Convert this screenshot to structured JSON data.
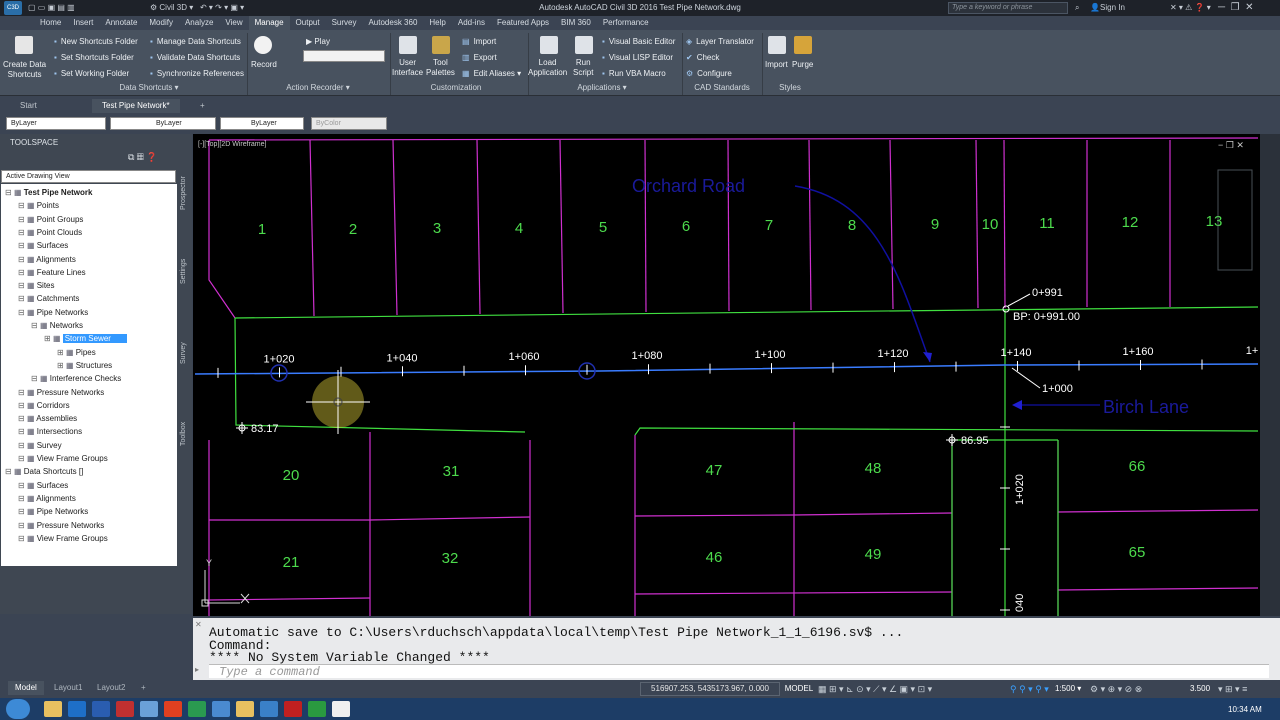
{
  "titlebar": {
    "app_label": "C3D",
    "workspace": "Civil 3D",
    "title": "Autodesk AutoCAD Civil 3D 2016    Test Pipe Network.dwg",
    "search_placeholder": "Type a keyword or phrase",
    "sign_in": "Sign In"
  },
  "ribbon_tabs": [
    "Home",
    "Insert",
    "Annotate",
    "Modify",
    "Analyze",
    "View",
    "Manage",
    "Output",
    "Survey",
    "Autodesk 360",
    "Help",
    "Add-ins",
    "Featured Apps",
    "BIM 360",
    "Performance"
  ],
  "active_tab": "Manage",
  "ribbon": {
    "create_ds": "Create Data\nShortcuts",
    "ds_items": [
      "New Shortcuts Folder",
      "Set Shortcuts Folder",
      "Set Working Folder"
    ],
    "ds_items2": [
      "Manage Data Shortcuts",
      "Validate Data Shortcuts",
      "Synchronize References"
    ],
    "ds_panel": "Data Shortcuts ▾",
    "record": "Record",
    "play": "Play",
    "action_panel": "Action Recorder ▾",
    "cui": "User\nInterface",
    "tool_palettes": "Tool\nPalettes",
    "cust_items": [
      "Import",
      "Export",
      "Edit Aliases ▾"
    ],
    "cust_panel": "Customization",
    "load_app": "Load\nApplication",
    "run_script": "Run\nScript",
    "app_items": [
      "Visual Basic Editor",
      "Visual LISP Editor",
      "Run VBA Macro"
    ],
    "app_panel": "Applications ▾",
    "cad_items": [
      "Layer Translator",
      "Check",
      "Configure"
    ],
    "cad_panel": "CAD Standards",
    "import": "Import",
    "purge": "Purge",
    "styles_panel": "Styles"
  },
  "doc_tabs": [
    "Start",
    "Test Pipe Network*"
  ],
  "properties": {
    "layer": "ByLayer",
    "linetype": "ByLayer",
    "lineweight": "ByLayer",
    "color": "ByColor"
  },
  "toolspace": {
    "title": "TOOLSPACE",
    "view": "Active Drawing View",
    "side_tabs": [
      "Prospector",
      "Settings",
      "Survey",
      "Toolbox"
    ],
    "tree": [
      {
        "t": "Test Pipe Network",
        "l": 0,
        "b": true
      },
      {
        "t": "Points",
        "l": 1
      },
      {
        "t": "Point Groups",
        "l": 1
      },
      {
        "t": "Point Clouds",
        "l": 1
      },
      {
        "t": "Surfaces",
        "l": 1
      },
      {
        "t": "Alignments",
        "l": 1
      },
      {
        "t": "Feature Lines",
        "l": 1
      },
      {
        "t": "Sites",
        "l": 1
      },
      {
        "t": "Catchments",
        "l": 1
      },
      {
        "t": "Pipe Networks",
        "l": 1
      },
      {
        "t": "Networks",
        "l": 2
      },
      {
        "t": "Storm Sewer",
        "l": 3,
        "sel": true
      },
      {
        "t": "Pipes",
        "l": 4
      },
      {
        "t": "Structures",
        "l": 4
      },
      {
        "t": "Interference Checks",
        "l": 2
      },
      {
        "t": "Pressure Networks",
        "l": 1
      },
      {
        "t": "Corridors",
        "l": 1
      },
      {
        "t": "Assemblies",
        "l": 1
      },
      {
        "t": "Intersections",
        "l": 1
      },
      {
        "t": "Survey",
        "l": 1
      },
      {
        "t": "View Frame Groups",
        "l": 1
      },
      {
        "t": "Data Shortcuts []",
        "l": 0
      },
      {
        "t": "Surfaces",
        "l": 1
      },
      {
        "t": "Alignments",
        "l": 1
      },
      {
        "t": "Pipe Networks",
        "l": 1
      },
      {
        "t": "Pressure Networks",
        "l": 1
      },
      {
        "t": "View Frame Groups",
        "l": 1
      }
    ]
  },
  "viewport": {
    "label": "[-][Top][2D Wireframe]",
    "road1": "Orchard Road",
    "road2": "Birch Lane",
    "lots_top": [
      "1",
      "2",
      "3",
      "4",
      "5",
      "6",
      "7",
      "8",
      "9",
      "10",
      "11",
      "12",
      "13"
    ],
    "lots_bottom": [
      "20",
      "31",
      "47",
      "48",
      "66",
      "21",
      "32",
      "46",
      "49",
      "65"
    ],
    "stations": [
      "1+020",
      "1+040",
      "1+060",
      "1+080",
      "1+100",
      "1+120",
      "1+140",
      "1+160",
      "1+"
    ],
    "sta_0991": "0+991",
    "bp": "BP:  0+991.00",
    "sta_1000": "1+000",
    "elev1": "83.17",
    "elev2": "86.95",
    "vsta1": "1+020",
    "vsta2": "040",
    "ucs_y": "Y"
  },
  "command": {
    "lines": [
      "Automatic save to C:\\Users\\rduchsch\\appdata\\local\\temp\\Test Pipe Network_1_1_6196.sv$ ...",
      "Command:",
      "**** No System Variable Changed ****"
    ],
    "placeholder": "Type a command"
  },
  "layout_tabs": [
    "Model",
    "Layout1",
    "Layout2"
  ],
  "status": {
    "coords": "516907.253, 5435173.967, 0.000",
    "model": "MODEL",
    "scale": "1:500 ▾",
    "value": "3.500"
  },
  "taskbar": {
    "time": "10:34 AM"
  }
}
